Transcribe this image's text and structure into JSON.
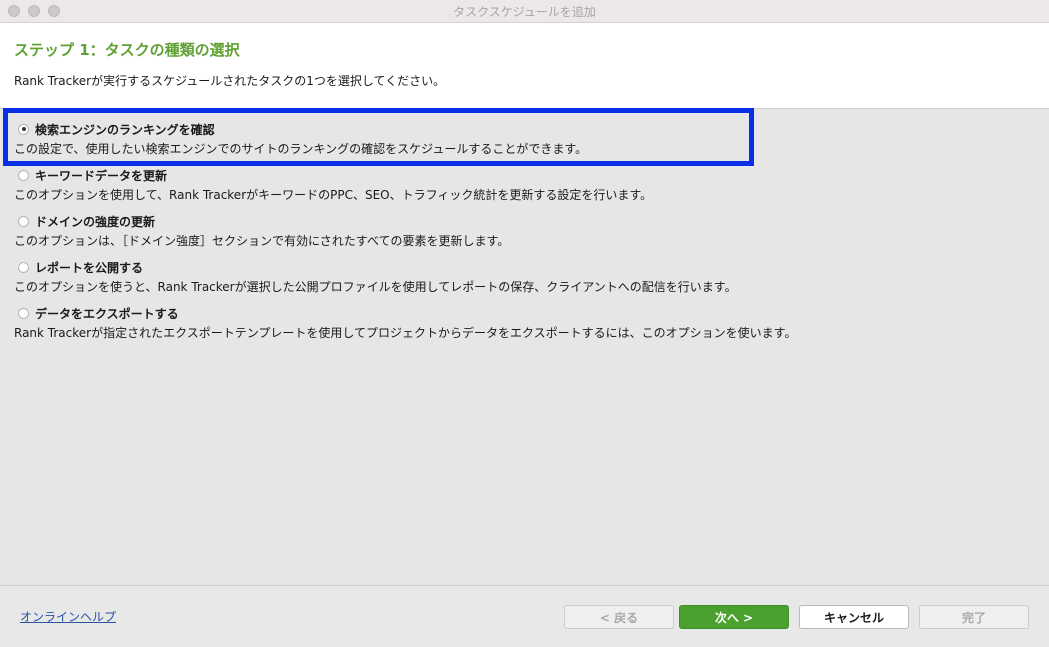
{
  "window": {
    "title": "タスクスケジュールを追加"
  },
  "header": {
    "step_title": "ステップ 1：タスクの種類の選択",
    "description": "Rank Trackerが実行するスケジュールされたタスクの1つを選択してください。"
  },
  "options": [
    {
      "label": "検索エンジンのランキングを確認",
      "description": "この設定で、使用したい検索エンジンでのサイトのランキングの確認をスケジュールすることができます。",
      "selected": true
    },
    {
      "label": "キーワードデータを更新",
      "description": "このオプションを使用して、Rank TrackerがキーワードのPPC、SEO、トラフィック統計を更新する設定を行います。",
      "selected": false
    },
    {
      "label": "ドメインの強度の更新",
      "description": "このオプションは、［ドメイン強度］セクションで有効にされたすべての要素を更新します。",
      "selected": false
    },
    {
      "label": "レポートを公開する",
      "description": "このオプションを使うと、Rank Trackerが選択した公開プロファイルを使用してレポートの保存、クライアントへの配信を行います。",
      "selected": false
    },
    {
      "label": "データをエクスポートする",
      "description": "Rank Trackerが指定されたエクスポートテンプレートを使用してプロジェクトからデータをエクスポートするには、このオプションを使います。",
      "selected": false
    }
  ],
  "footer": {
    "help_link": "オンラインヘルプ",
    "back_label": "< 戻る",
    "next_label": "次へ >",
    "cancel_label": "キャンセル",
    "finish_label": "完了"
  },
  "colors": {
    "accent_green": "#5fa133",
    "next_button": "#4aa12e",
    "highlight_box": "#0a2ee6",
    "link": "#2952a3"
  }
}
